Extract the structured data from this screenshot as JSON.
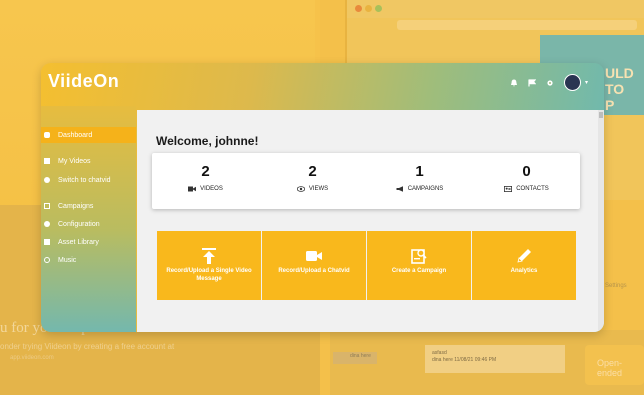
{
  "background": {
    "left_text_line1": "u for your response!",
    "left_text_line2": "onder trying Viideon by creating a free account at",
    "left_text_line3": "app.viideon.com",
    "right_text": "ULD\nTO\nP",
    "settings_text": "Settings",
    "open_ended_text": "Open-ended",
    "row_text": "dina here",
    "row2_line1": "asfasd",
    "row2_line2": "dina here 11/08/21 09:46 PM"
  },
  "app": {
    "logo": "ViideOn"
  },
  "topbar": {
    "icons": [
      "bell-icon",
      "flag-icon",
      "gear-icon"
    ],
    "avatar": "avatar"
  },
  "sidebar": {
    "items": [
      {
        "label": "Dashboard",
        "icon": "dashboard-icon",
        "active": true
      },
      {
        "label": "My Videos",
        "icon": "video-icon",
        "active": false
      },
      {
        "label": "Switch to chatvid",
        "icon": "chat-icon",
        "active": false
      },
      {
        "label": "Campaigns",
        "icon": "campaign-icon",
        "active": false
      },
      {
        "label": "Configuration",
        "icon": "config-icon",
        "active": false
      },
      {
        "label": "Asset Library",
        "icon": "folder-icon",
        "active": false
      },
      {
        "label": "Music",
        "icon": "music-icon",
        "active": false
      }
    ]
  },
  "main": {
    "welcome": "Welcome, johnne!",
    "stats": [
      {
        "value": "2",
        "label": "VIDEOS",
        "icon": "video-camera-icon"
      },
      {
        "value": "2",
        "label": "VIEWS",
        "icon": "eye-icon"
      },
      {
        "value": "1",
        "label": "CAMPAIGNS",
        "icon": "megaphone-icon"
      },
      {
        "value": "0",
        "label": "CONTACTS",
        "icon": "contacts-icon"
      }
    ],
    "actions": [
      {
        "label": "Record/Upload a Single Video Message",
        "icon": "upload-icon"
      },
      {
        "label": "Record/Upload a Chatvid",
        "icon": "video-record-icon"
      },
      {
        "label": "Create a Campaign",
        "icon": "campaign-create-icon"
      },
      {
        "label": "Analytics",
        "icon": "pencil-icon"
      }
    ]
  },
  "colors": {
    "accent": "#f9b81c",
    "teal": "#67b8b7"
  }
}
